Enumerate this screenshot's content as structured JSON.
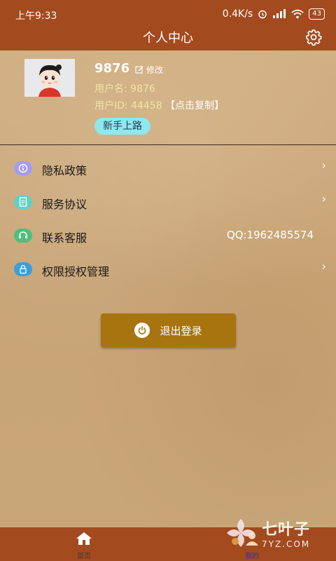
{
  "status_bar": {
    "time": "上午9:33",
    "speed": "0.4K/s",
    "battery": "43"
  },
  "header": {
    "title": "个人中心",
    "settings_icon": "gear-icon"
  },
  "profile": {
    "name": "9876",
    "edit_label": "修改",
    "username_line": "用户名: 9876",
    "userid_label": "用户ID: 44458",
    "copy_label": "【点击复制】",
    "badge_label": "新手上路"
  },
  "menu": {
    "items": [
      {
        "label": "隐私政策",
        "icon": "privacy-icon",
        "color": "#a59cf0"
      },
      {
        "label": "服务协议",
        "icon": "document-icon",
        "color": "#63d0c8"
      },
      {
        "label": "联系客服",
        "icon": "support-icon",
        "color": "#4cc07a",
        "value": "QQ:1962485574"
      },
      {
        "label": "权限授权管理",
        "icon": "lock-icon",
        "color": "#3aa0d8"
      }
    ]
  },
  "logout": {
    "label": "退出登录"
  },
  "tabbar": {
    "tabs": [
      {
        "label": "首页",
        "icon": "home-icon"
      },
      {
        "label": "我的",
        "icon": "person-icon"
      }
    ]
  },
  "watermark": {
    "brand": "七叶子",
    "domain": "7YZ.COM"
  }
}
